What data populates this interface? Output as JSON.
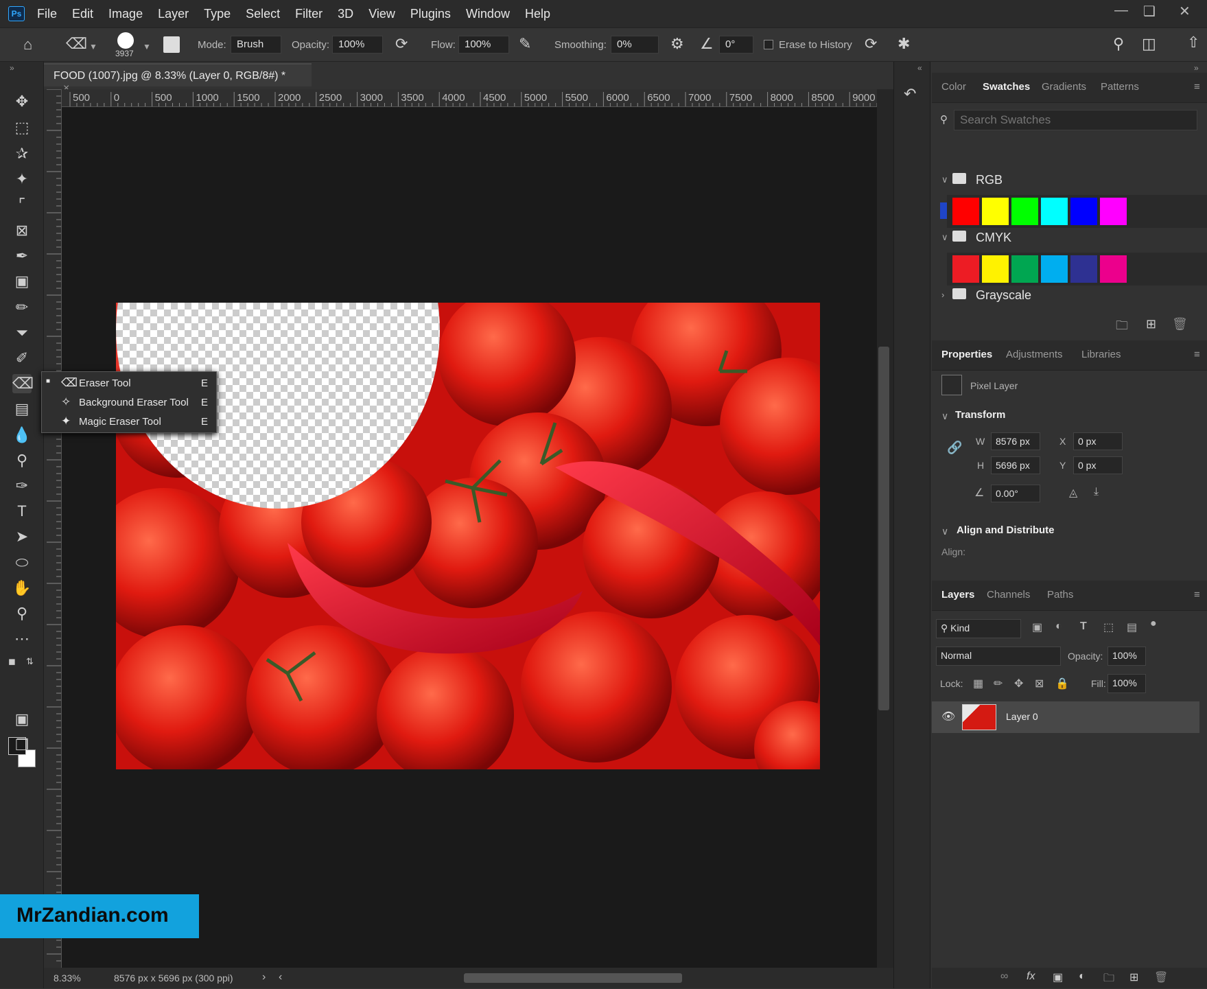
{
  "app": {
    "logo": "Ps"
  },
  "menu": [
    "File",
    "Edit",
    "Image",
    "Layer",
    "Type",
    "Select",
    "Filter",
    "3D",
    "View",
    "Plugins",
    "Window",
    "Help"
  ],
  "options_bar": {
    "brush_size": "3937",
    "mode_label": "Mode:",
    "mode_value": "Brush",
    "opacity_label": "Opacity:",
    "opacity_value": "100%",
    "flow_label": "Flow:",
    "flow_value": "100%",
    "smoothing_label": "Smoothing:",
    "smoothing_value": "0%",
    "angle_value": "0°",
    "erase_history_label": "Erase to History"
  },
  "document": {
    "tab_title": "FOOD (1007).jpg @ 8.33% (Layer 0, RGB/8#) *",
    "close": "×"
  },
  "ruler_top": [
    "500",
    "0",
    "500",
    "1000",
    "1500",
    "2000",
    "2500",
    "3000",
    "3500",
    "4000",
    "4500",
    "5000",
    "5500",
    "6000",
    "6500",
    "7000",
    "7500",
    "8000",
    "8500",
    "9000"
  ],
  "tool_flyout": [
    {
      "label": "Eraser Tool",
      "shortcut": "E",
      "icon": "eraser-icon"
    },
    {
      "label": "Background Eraser Tool",
      "shortcut": "E",
      "icon": "background-eraser-icon"
    },
    {
      "label": "Magic Eraser Tool",
      "shortcut": "E",
      "icon": "magic-eraser-icon"
    }
  ],
  "status": {
    "zoom": "8.33%",
    "doc_info": "8576 px x 5696 px (300 ppi)"
  },
  "swatches_panel": {
    "tabs": [
      "Color",
      "Swatches",
      "Gradients",
      "Patterns"
    ],
    "active_tab": "Swatches",
    "search_placeholder": "Search Swatches",
    "recent": [
      "#1f45c8",
      "#d9d9d9",
      "#ffffff",
      "#a0103a",
      "#6a0a22",
      "#8a8a8a",
      "#b01040",
      "#ffffff",
      "#222222",
      "#8a6a4a",
      "#3a3a44",
      "#1a1a1a",
      "#1840d0",
      "#1a6ad8",
      "#e0202a"
    ],
    "groups": [
      {
        "name": "RGB",
        "expanded": true,
        "colors": [
          "#ff0000",
          "#ffff00",
          "#00ff00",
          "#00ffff",
          "#0000ff",
          "#ff00ff"
        ]
      },
      {
        "name": "CMYK",
        "expanded": true,
        "colors": [
          "#ed1c24",
          "#fff200",
          "#00a651",
          "#00aeef",
          "#2e3192",
          "#ec008c"
        ]
      },
      {
        "name": "Grayscale",
        "expanded": false,
        "colors": []
      }
    ]
  },
  "properties_panel": {
    "tabs": [
      "Properties",
      "Adjustments",
      "Libraries"
    ],
    "active_tab": "Properties",
    "layer_type": "Pixel Layer",
    "transform_header": "Transform",
    "w_label": "W",
    "w_value": "8576 px",
    "h_label": "H",
    "h_value": "5696 px",
    "x_label": "X",
    "x_value": "0 px",
    "y_label": "Y",
    "y_value": "0 px",
    "angle_value": "0.00°",
    "align_header": "Align and Distribute",
    "align_label": "Align:"
  },
  "layers_panel": {
    "tabs": [
      "Layers",
      "Channels",
      "Paths"
    ],
    "active_tab": "Layers",
    "filter_kind": "Kind",
    "blend_mode": "Normal",
    "opacity_label": "Opacity:",
    "opacity_value": "100%",
    "lock_label": "Lock:",
    "fill_label": "Fill:",
    "fill_value": "100%",
    "layers": [
      {
        "name": "Layer 0",
        "visible": true
      }
    ]
  },
  "watermark": "MrZandian.com",
  "colors": {
    "accent": "#31a8ff",
    "panel_bg": "#323232",
    "canvas_bg": "#1a1a1a",
    "watermark_bg": "#12a2dd"
  }
}
